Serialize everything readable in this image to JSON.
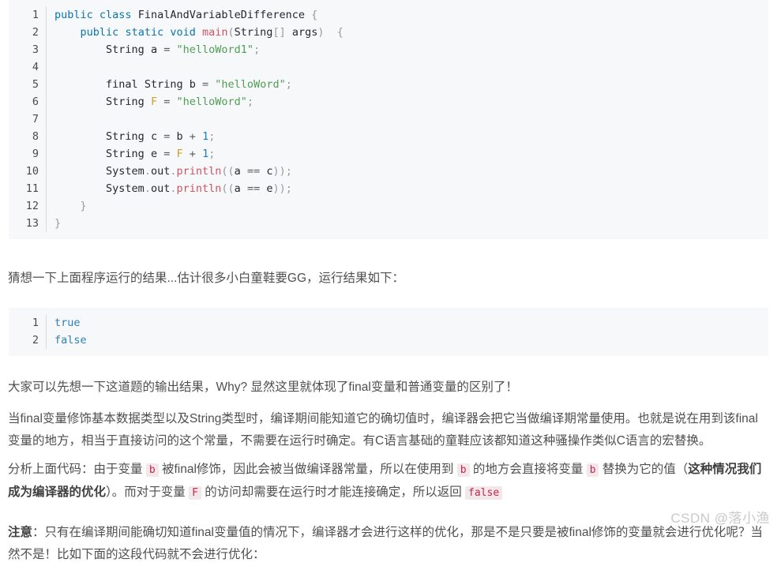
{
  "colors": {
    "code_background": "#f6f8fa",
    "keyword": "#0b76a8",
    "function": "#d4525f",
    "string": "#4f9e54",
    "number": "#1f7bbf",
    "variable": "#c9a227",
    "inline_code_text": "#c7254e",
    "inline_code_bg": "#f2e8ea",
    "body_text": "#4f4f4f",
    "watermark": "#c9c9c9"
  },
  "code_block_1": {
    "language": "java",
    "line_numbers": [
      "1",
      "2",
      "3",
      "4",
      "5",
      "6",
      "7",
      "8",
      "9",
      "10",
      "11",
      "12",
      "13"
    ],
    "lines": [
      "public class FinalAndVariableDifference {",
      "    public static void main(String[] args)  {",
      "        String a = \"helloWord1\";",
      "",
      "        final String b = \"helloWord\";",
      "        String F = \"helloWord\";",
      "",
      "        String c = b + 1;",
      "        String e = F + 1;",
      "        System.out.println((a == c));",
      "        System.out.println((a == e));",
      "    }",
      "}"
    ]
  },
  "paragraph_1": "猜想一下上面程序运行的结果...估计很多小白童鞋要GG，运行结果如下：",
  "code_block_2": {
    "language": "output",
    "line_numbers": [
      "1",
      "2"
    ],
    "lines": [
      "true",
      "false"
    ]
  },
  "paragraph_2": "大家可以先想一下这道题的输出结果，Why? 显然这里就体现了final变量和普通变量的区别了！",
  "paragraph_3": "当final变量修饰基本数据类型以及String类型时，编译期间能知道它的确切值时，编译器会把它当做编译期常量使用。也就是说在用到该final变量的地方，相当于直接访问的这个常量，不需要在运行时确定。有C语言基础的童鞋应该都知道这种骚操作类似C语言的宏替换。",
  "paragraph_4": {
    "seg_1": "分析上面代码：由于变量 ",
    "code_b1": "b",
    "seg_2": " 被final修饰，因此会被当做编译器常量，所以在使用到 ",
    "code_b2": "b",
    "seg_3": " 的地方会直接将变量 ",
    "code_b3": "b",
    "seg_4": " 替换为它的值（",
    "bold_1": "这种情况我们成为编译器的优化",
    "seg_5": "）。而对于变量 ",
    "code_F": "F",
    "seg_6": " 的访问却需要在运行时才能连接确定，所以返回 ",
    "code_false": "false"
  },
  "paragraph_5": {
    "bold_note": "注意",
    "text": "：只有在编译期间能确切知道final变量值的情况下，编译器才会进行这样的优化，那是不是只要是被final修饰的变量就会进行优化呢？当然不是！比如下面的这段代码就不会进行优化："
  },
  "watermark": "CSDN @落小渔"
}
